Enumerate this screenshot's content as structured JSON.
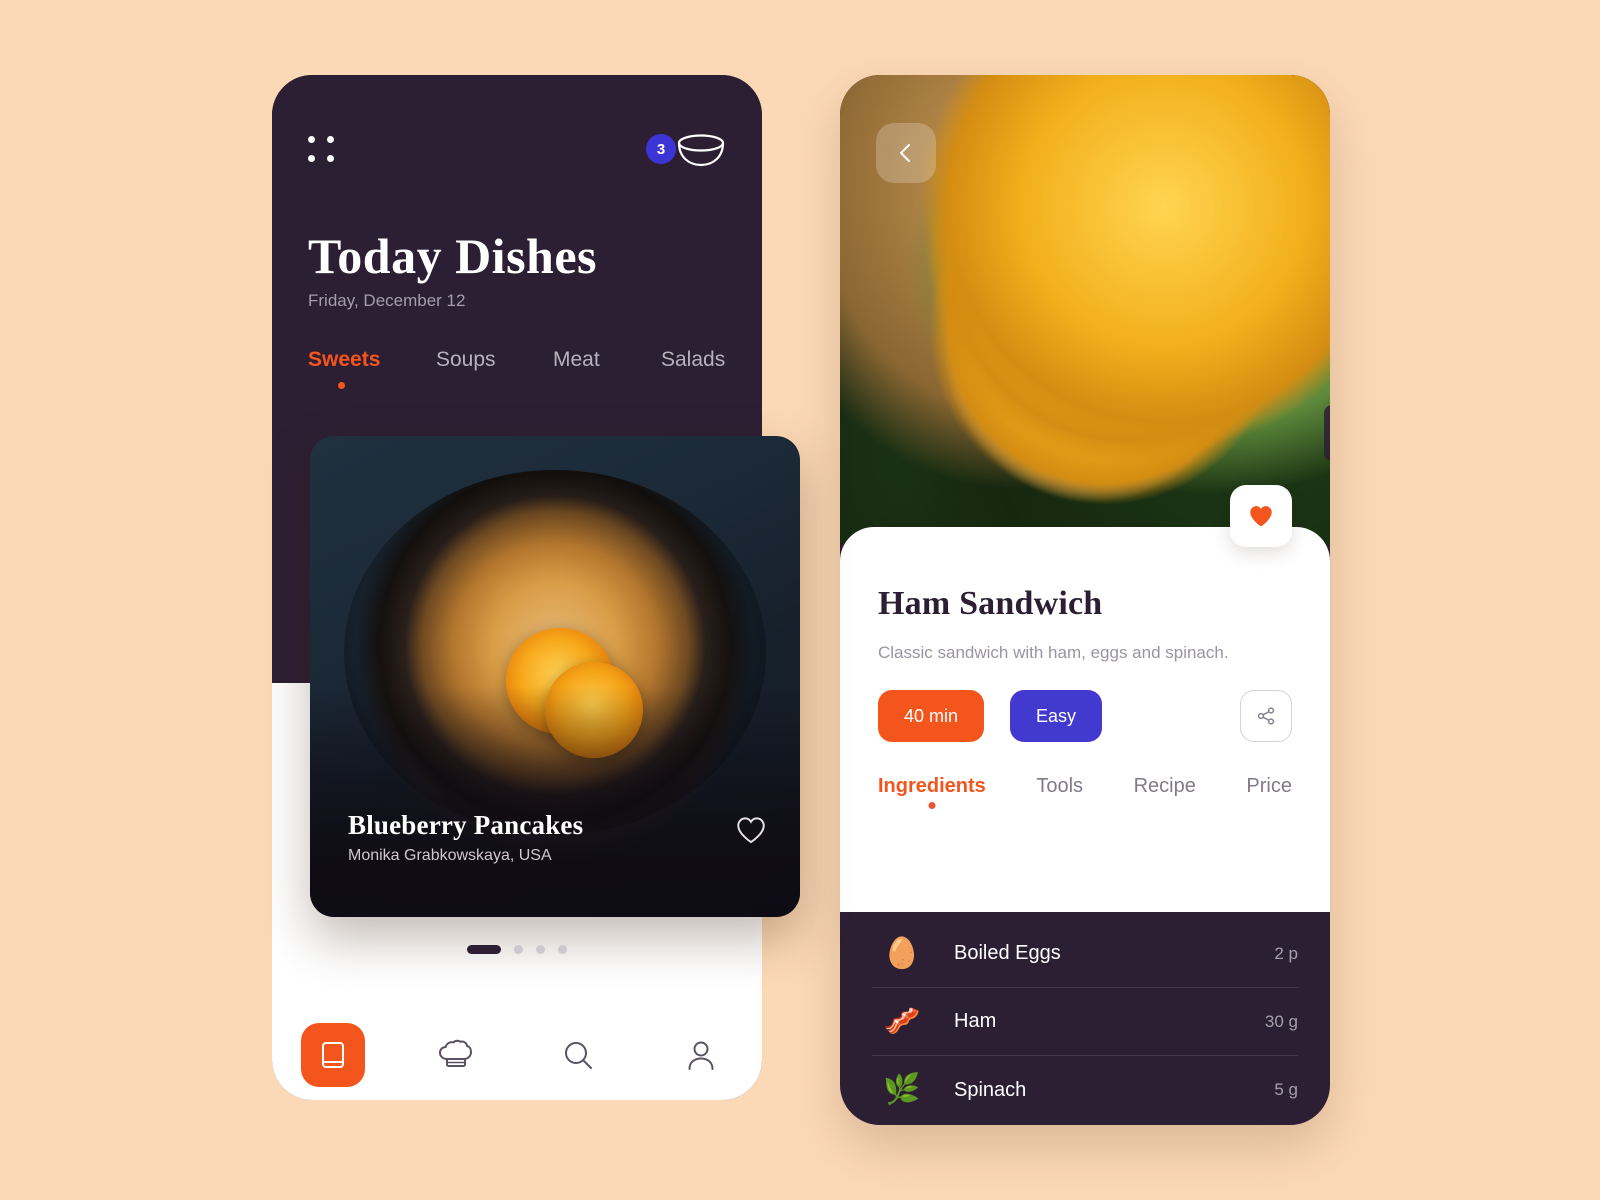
{
  "theme": {
    "background": "#fcd9b6",
    "dark": "#2c1f33",
    "accent_orange": "#f4551c",
    "accent_blue": "#4239cf",
    "badge_blue": "#3d34d6",
    "white": "#ffffff",
    "muted": "#a69cab"
  },
  "left_screen": {
    "topbar": {
      "grid_icon": "grid-dots-icon",
      "cart_icon": "bowl-icon",
      "cart_count": "3"
    },
    "title": "Today Dishes",
    "date": "Friday, December 12",
    "tabs": [
      {
        "label": "Sweets",
        "active": true
      },
      {
        "label": "Soups",
        "active": false
      },
      {
        "label": "Meat",
        "active": false
      },
      {
        "label": "Salads",
        "active": false
      }
    ],
    "dish_card": {
      "name": "Blueberry Pancakes",
      "author": "Monika Grabkowskaya, USA",
      "favorite_icon": "heart-outline-icon",
      "photo_alt": "blueberry-pancakes-skillet"
    },
    "pagination": {
      "total": 4,
      "active_index": 0
    },
    "bottom_nav": [
      {
        "name": "recipes",
        "icon": "book-icon",
        "active": true
      },
      {
        "name": "chef",
        "icon": "chef-hat-icon",
        "active": false
      },
      {
        "name": "search",
        "icon": "search-icon",
        "active": false
      },
      {
        "name": "profile",
        "icon": "person-icon",
        "active": false
      }
    ]
  },
  "right_screen": {
    "back_icon": "chevron-left-icon",
    "favorite_icon": "heart-filled-icon",
    "share_icon": "share-icon",
    "photo_alt": "ham-sandwich-eggs-spinach",
    "title": "Ham Sandwich",
    "description": "Classic sandwich with ham, eggs and spinach.",
    "pills": [
      {
        "label": "40 min",
        "kind": "time"
      },
      {
        "label": "Easy",
        "kind": "difficulty"
      }
    ],
    "tabs": [
      {
        "label": "Ingredients",
        "active": true
      },
      {
        "label": "Tools",
        "active": false
      },
      {
        "label": "Recipe",
        "active": false
      },
      {
        "label": "Price",
        "active": false
      }
    ],
    "ingredients": [
      {
        "icon": "🥚",
        "name": "Boiled Eggs",
        "qty": "2 p"
      },
      {
        "icon": "🥓",
        "name": "Ham",
        "qty": "30 g"
      },
      {
        "icon": "🌿",
        "name": "Spinach",
        "qty": "5 g"
      }
    ]
  }
}
